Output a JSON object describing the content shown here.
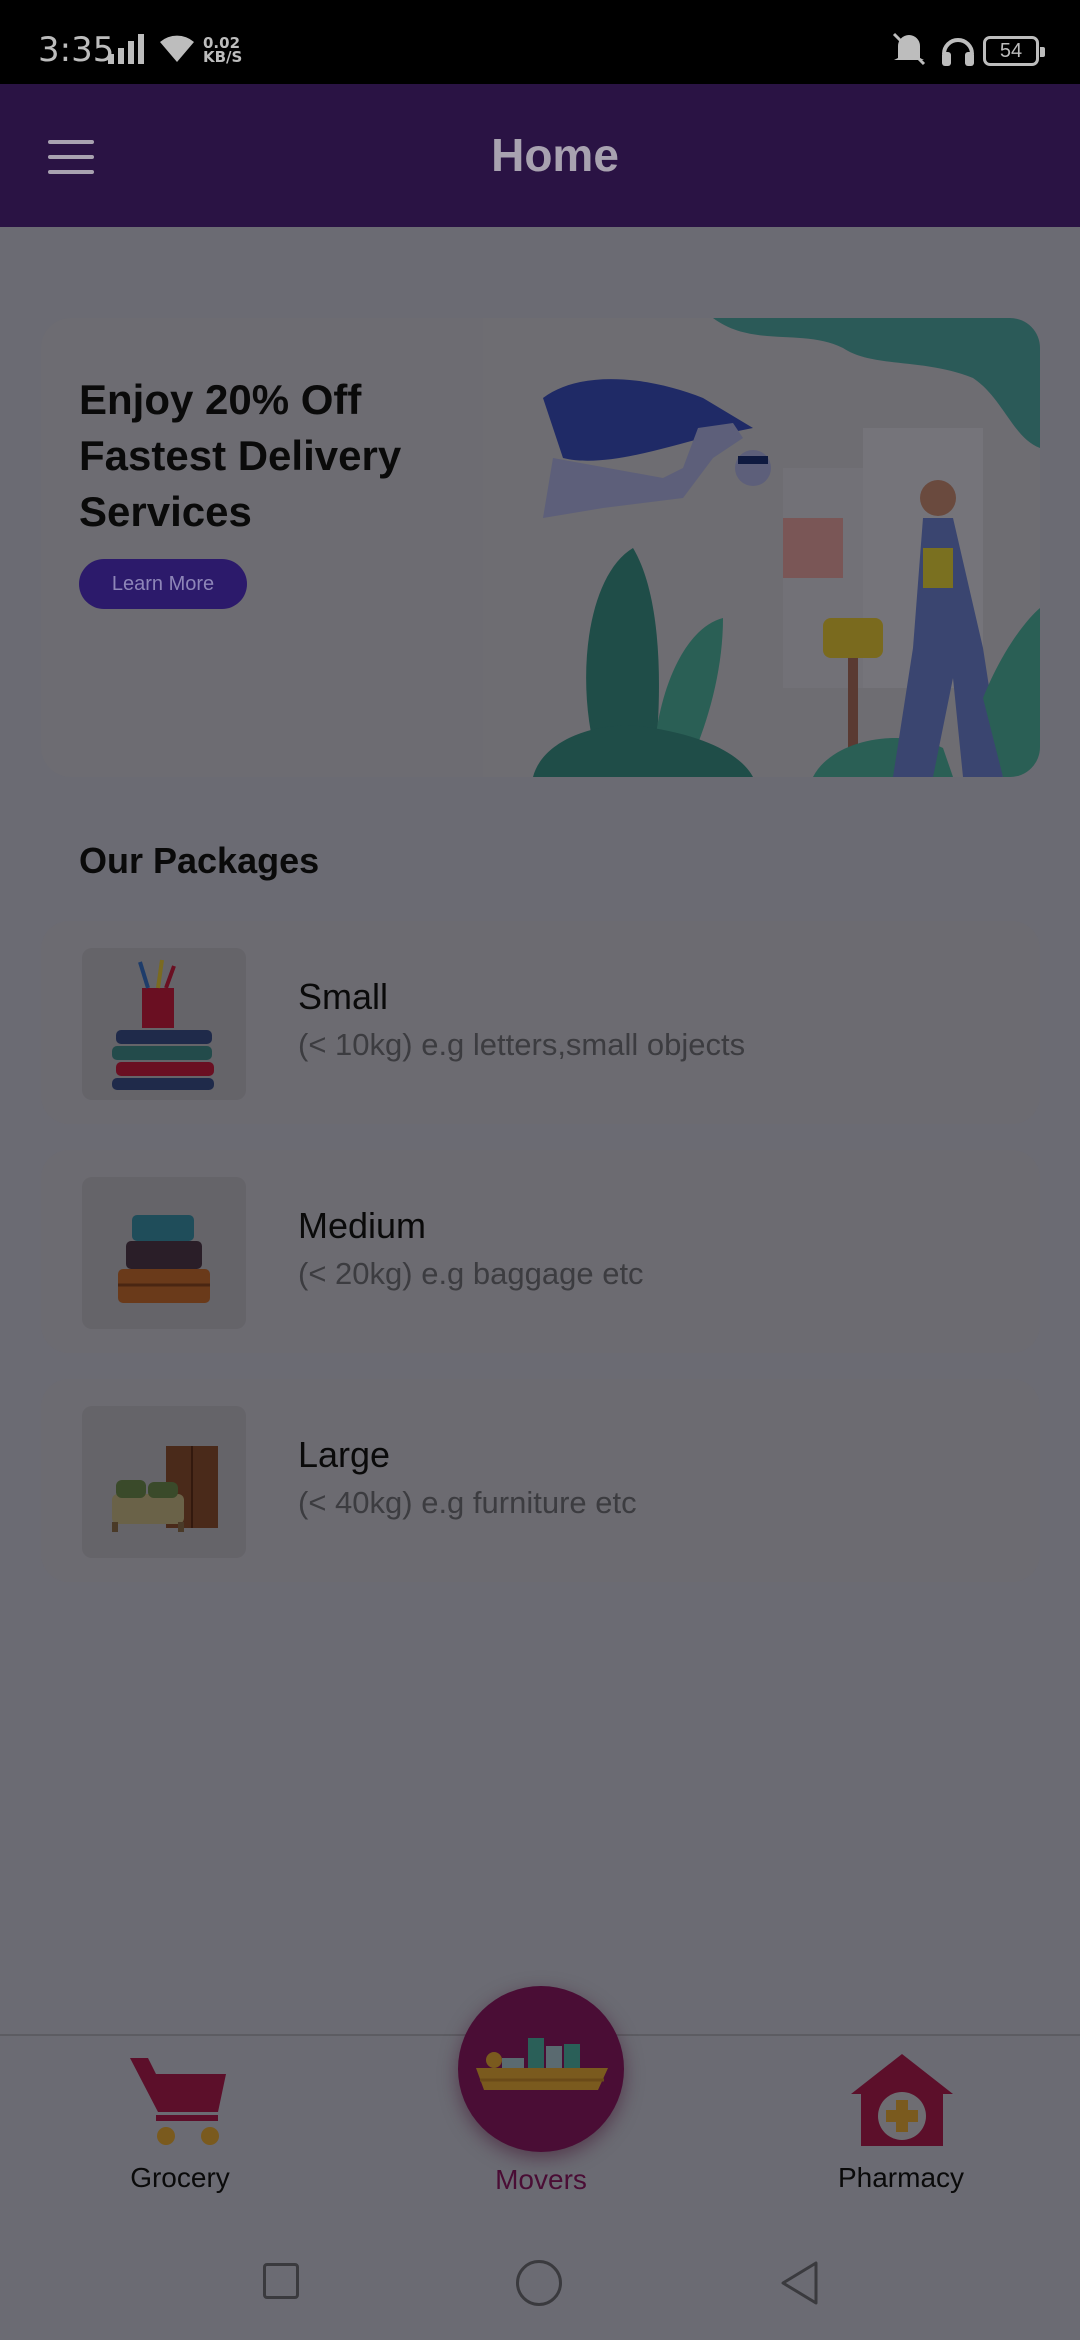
{
  "status": {
    "time": "3:35",
    "rate_top": "0.02",
    "rate_bottom": "KB/S",
    "battery": "54"
  },
  "appbar": {
    "title": "Home"
  },
  "promo": {
    "line1": "Enjoy 20% Off",
    "line2": "Fastest Delivery",
    "line3": "Services",
    "button": "Learn More"
  },
  "packages": {
    "title": "Our Packages",
    "items": [
      {
        "name": "Small",
        "desc": "(< 10kg) e.g letters,small objects"
      },
      {
        "name": "Medium",
        "desc": "(< 20kg) e.g baggage etc"
      },
      {
        "name": "Large",
        "desc": "(< 40kg) e.g furniture etc"
      }
    ]
  },
  "nav": {
    "left": "Grocery",
    "center": "Movers",
    "right": "Pharmacy"
  },
  "colors": {
    "header": "#2a1344",
    "accent": "#4a0d35",
    "button": "#2c1a6b"
  }
}
